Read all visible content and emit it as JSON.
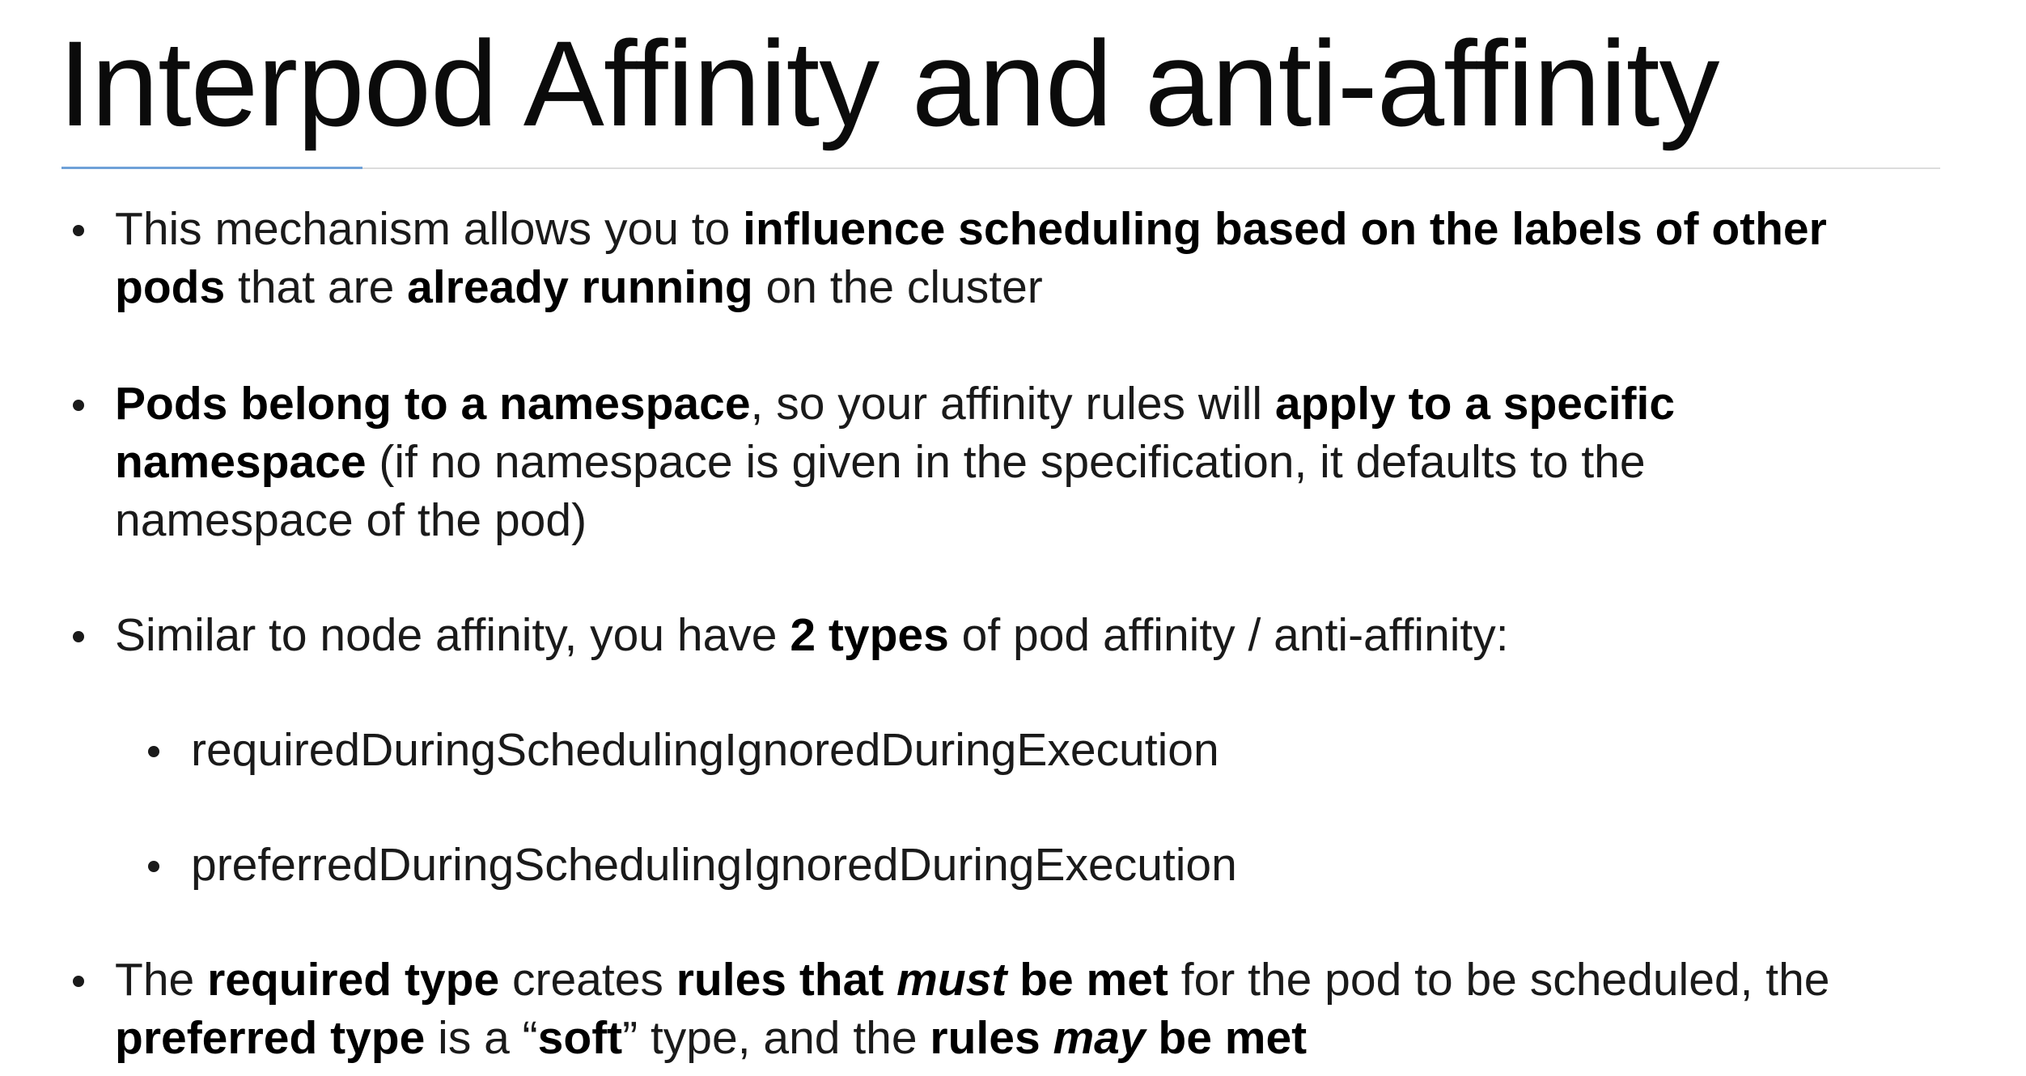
{
  "slide": {
    "title": "Interpod Affinity and anti-affinity",
    "bullets": [
      {
        "lines": [
          [
            {
              "t": "This mechanism allows you to ",
              "s": "n"
            },
            {
              "t": "influence scheduling based on the labels of other",
              "s": "b"
            }
          ],
          [
            {
              "t": "pods",
              "s": "b"
            },
            {
              "t": " that are ",
              "s": "n"
            },
            {
              "t": "already running",
              "s": "b"
            },
            {
              "t": " on the cluster",
              "s": "n"
            }
          ]
        ]
      },
      {
        "lines": [
          [
            {
              "t": "Pods belong to a namespace",
              "s": "b"
            },
            {
              "t": ", so your affinity rules will ",
              "s": "n"
            },
            {
              "t": "apply to a specific",
              "s": "b"
            }
          ],
          [
            {
              "t": "namespace",
              "s": "b"
            },
            {
              "t": " (if no namespace is given in the specification, it defaults to the",
              "s": "n"
            }
          ],
          [
            {
              "t": "namespace of the pod)",
              "s": "n"
            }
          ]
        ]
      },
      {
        "lines": [
          [
            {
              "t": "Similar to node affinity, you have ",
              "s": "n"
            },
            {
              "t": "2 types",
              "s": "b"
            },
            {
              "t": " of pod affinity / anti-affinity:",
              "s": "n"
            }
          ]
        ]
      },
      {
        "lines": [
          [
            {
              "t": "requiredDuringSchedulingIgnoredDuringExecution",
              "s": "n"
            }
          ]
        ]
      },
      {
        "lines": [
          [
            {
              "t": "preferredDuringSchedulingIgnoredDuringExecution",
              "s": "n"
            }
          ]
        ]
      },
      {
        "lines": [
          [
            {
              "t": "The ",
              "s": "n"
            },
            {
              "t": "required type",
              "s": "b"
            },
            {
              "t": " creates ",
              "s": "n"
            },
            {
              "t": "rules that ",
              "s": "b"
            },
            {
              "t": "must",
              "s": "bi"
            },
            {
              "t": " be met",
              "s": "b"
            },
            {
              "t": " for the pod to be scheduled, the",
              "s": "n"
            }
          ],
          [
            {
              "t": "preferred type",
              "s": "b"
            },
            {
              "t": " is a “",
              "s": "n"
            },
            {
              "t": "soft",
              "s": "b"
            },
            {
              "t": "” type, and the ",
              "s": "n"
            },
            {
              "t": "rules ",
              "s": "b"
            },
            {
              "t": "may",
              "s": "bi"
            },
            {
              "t": " be met",
              "s": "b"
            }
          ]
        ]
      }
    ]
  }
}
